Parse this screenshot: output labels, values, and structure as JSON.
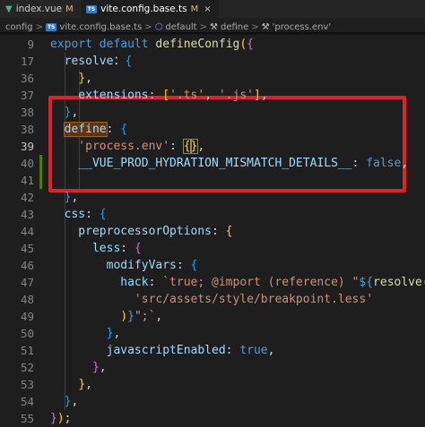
{
  "tabs": [
    {
      "label": "index.vue",
      "status": "M",
      "icon": "vue-icon",
      "active": false
    },
    {
      "label": "vite.config.base.ts",
      "status": "M",
      "icon": "ts-icon",
      "active": true
    }
  ],
  "tab_close_glyph": "×",
  "ts_badge": "TS",
  "breadcrumb": {
    "items": [
      "config",
      "vite.config.base.ts",
      "default",
      "define",
      "'process.env'"
    ],
    "sep": ">"
  },
  "editor": {
    "lines": [
      {
        "num": "9",
        "tokens": [
          [
            "k",
            "export "
          ],
          [
            "k",
            "default "
          ],
          [
            "fn",
            "defineConfig"
          ],
          [
            "b1",
            "("
          ],
          [
            "b2",
            "{"
          ]
        ]
      },
      {
        "num": "17",
        "tokens": [
          [
            "p",
            "  resolve"
          ],
          [
            "",
            "："
          ],
          [
            "b3",
            "{"
          ]
        ]
      },
      {
        "num": "36",
        "tokens": [
          [
            "",
            "    "
          ],
          [
            "b1",
            "}"
          ],
          [
            "",
            ","
          ]
        ]
      },
      {
        "num": "37",
        "tokens": [
          [
            "p",
            "    extensions"
          ],
          [
            "",
            ": "
          ],
          [
            "b1",
            "["
          ],
          [
            "s",
            "'.ts'"
          ],
          [
            "",
            ", "
          ],
          [
            "s",
            "'.js'"
          ],
          [
            "b1",
            "]"
          ],
          [
            "",
            ","
          ]
        ]
      },
      {
        "num": "38",
        "tokens": [
          [
            "",
            "  "
          ],
          [
            "b3",
            "}"
          ],
          [
            "",
            ","
          ]
        ]
      },
      {
        "num": "38",
        "tokens": [
          [
            "",
            "  "
          ],
          [
            "p hl",
            "define"
          ],
          [
            "",
            ": "
          ],
          [
            "b3",
            "{"
          ]
        ]
      },
      {
        "num": "39",
        "tokens": [
          [
            "s",
            "    'process.env'"
          ],
          [
            "",
            ": "
          ],
          [
            "b1 bm",
            "{"
          ],
          [
            "b1 bm",
            "}"
          ],
          [
            "",
            ","
          ]
        ]
      },
      {
        "num": "40",
        "tokens": [
          [
            "p",
            "    __VUE_PROD_HYDRATION_MISMATCH_DETAILS__"
          ],
          [
            "",
            ": "
          ],
          [
            "k",
            "false"
          ],
          [
            "",
            ","
          ]
        ]
      },
      {
        "num": "41",
        "tokens": [
          [
            "",
            ""
          ]
        ]
      },
      {
        "num": "42",
        "tokens": [
          [
            "",
            "  "
          ],
          [
            "b3",
            "}"
          ],
          [
            "",
            ","
          ]
        ]
      },
      {
        "num": "43",
        "tokens": [
          [
            "p",
            "  css"
          ],
          [
            "",
            ": "
          ],
          [
            "b3",
            "{"
          ]
        ]
      },
      {
        "num": "44",
        "tokens": [
          [
            "p",
            "    preprocessorOptions"
          ],
          [
            "",
            ": "
          ],
          [
            "b1",
            "{"
          ]
        ]
      },
      {
        "num": "45",
        "tokens": [
          [
            "p",
            "      less"
          ],
          [
            "",
            ": "
          ],
          [
            "b2",
            "{"
          ]
        ]
      },
      {
        "num": "46",
        "tokens": [
          [
            "p",
            "        modifyVars"
          ],
          [
            "",
            ": "
          ],
          [
            "b3",
            "{"
          ]
        ]
      },
      {
        "num": "47",
        "tokens": [
          [
            "p",
            "          hack"
          ],
          [
            "",
            ": "
          ],
          [
            "s",
            "`true; @import (reference) \""
          ],
          [
            "k",
            "${"
          ],
          [
            "fn",
            "resolve"
          ],
          [
            "b1",
            "("
          ]
        ]
      },
      {
        "num": "48",
        "tokens": [
          [
            "s",
            "            'src/assets/style/breakpoint.less'"
          ]
        ]
      },
      {
        "num": "49",
        "tokens": [
          [
            "",
            "          "
          ],
          [
            "b1",
            ")"
          ],
          [
            "k",
            "}"
          ],
          [
            "s",
            "\";`"
          ],
          [
            "",
            ","
          ]
        ]
      },
      {
        "num": "50",
        "tokens": [
          [
            "",
            "        "
          ],
          [
            "b3",
            "}"
          ],
          [
            "",
            ","
          ]
        ]
      },
      {
        "num": "51",
        "tokens": [
          [
            "p",
            "        javascriptEnabled"
          ],
          [
            "",
            ": "
          ],
          [
            "k",
            "true"
          ],
          [
            "",
            ","
          ]
        ]
      },
      {
        "num": "52",
        "tokens": [
          [
            "",
            "      "
          ],
          [
            "b2",
            "}"
          ],
          [
            "",
            ","
          ]
        ]
      },
      {
        "num": "53",
        "tokens": [
          [
            "",
            "    "
          ],
          [
            "b1",
            "}"
          ],
          [
            "",
            ","
          ]
        ]
      },
      {
        "num": "54",
        "tokens": [
          [
            "",
            "  "
          ],
          [
            "b3",
            "}"
          ],
          [
            "",
            ","
          ]
        ]
      },
      {
        "num": "55",
        "tokens": [
          [
            "b2",
            "}"
          ],
          [
            "b1",
            ")"
          ],
          [
            "",
            ";"
          ]
        ]
      }
    ],
    "current_line": "39",
    "modified_lines": [
      "40",
      "41"
    ]
  },
  "colors": {
    "highlight_box": "#e0202a",
    "keyword": "#569cd6",
    "string": "#ce9178",
    "property": "#9cdcfe"
  }
}
